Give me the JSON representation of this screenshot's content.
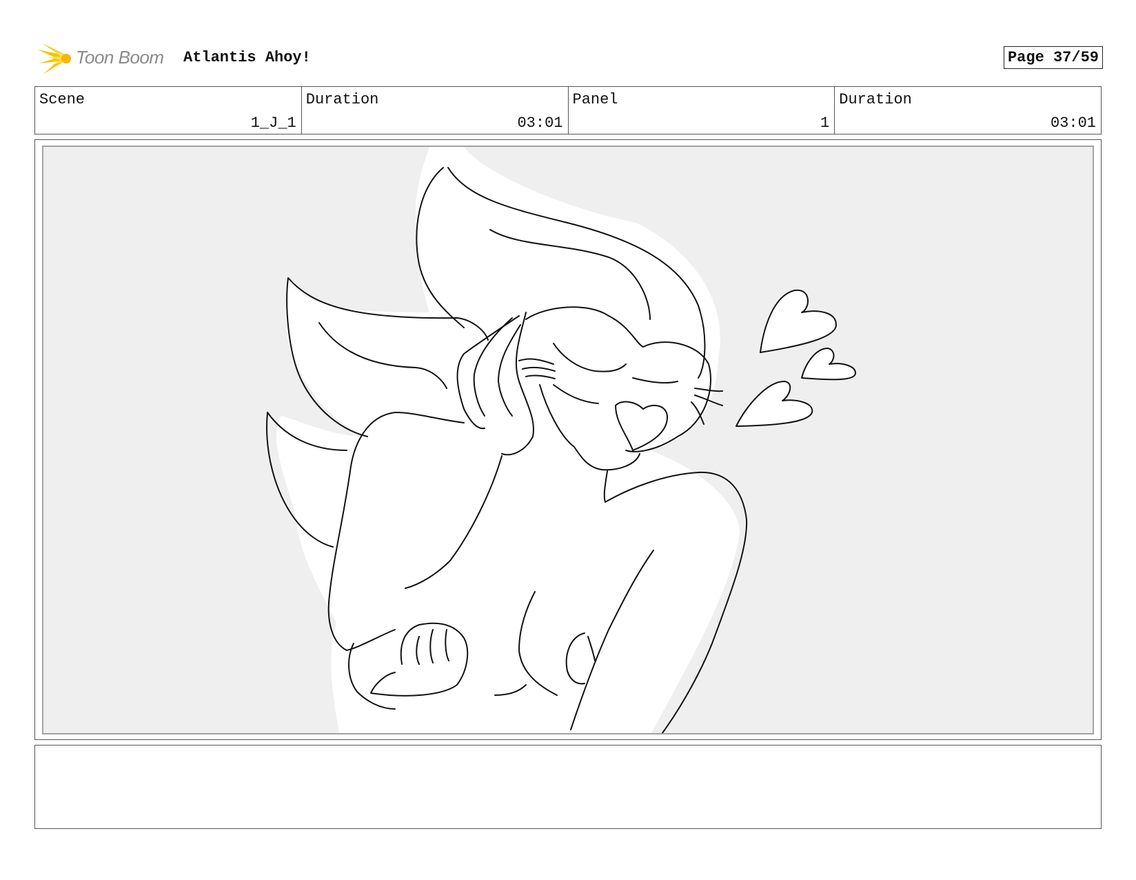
{
  "header": {
    "logo_text": "Toon Boom",
    "project_title": "Atlantis Ahoy!",
    "page_counter": "Page 37/59"
  },
  "info": {
    "scene_label": "Scene",
    "scene_value": "1_J_1",
    "scene_duration_label": "Duration",
    "scene_duration_value": "03:01",
    "panel_label": "Panel",
    "panel_value": "1",
    "panel_duration_label": "Duration",
    "panel_duration_value": "03:01"
  },
  "panel": {
    "background_color": "#efefef",
    "line_color": "#111111",
    "subject": "character-blushing-with-hearts"
  },
  "notes": {
    "text": ""
  }
}
